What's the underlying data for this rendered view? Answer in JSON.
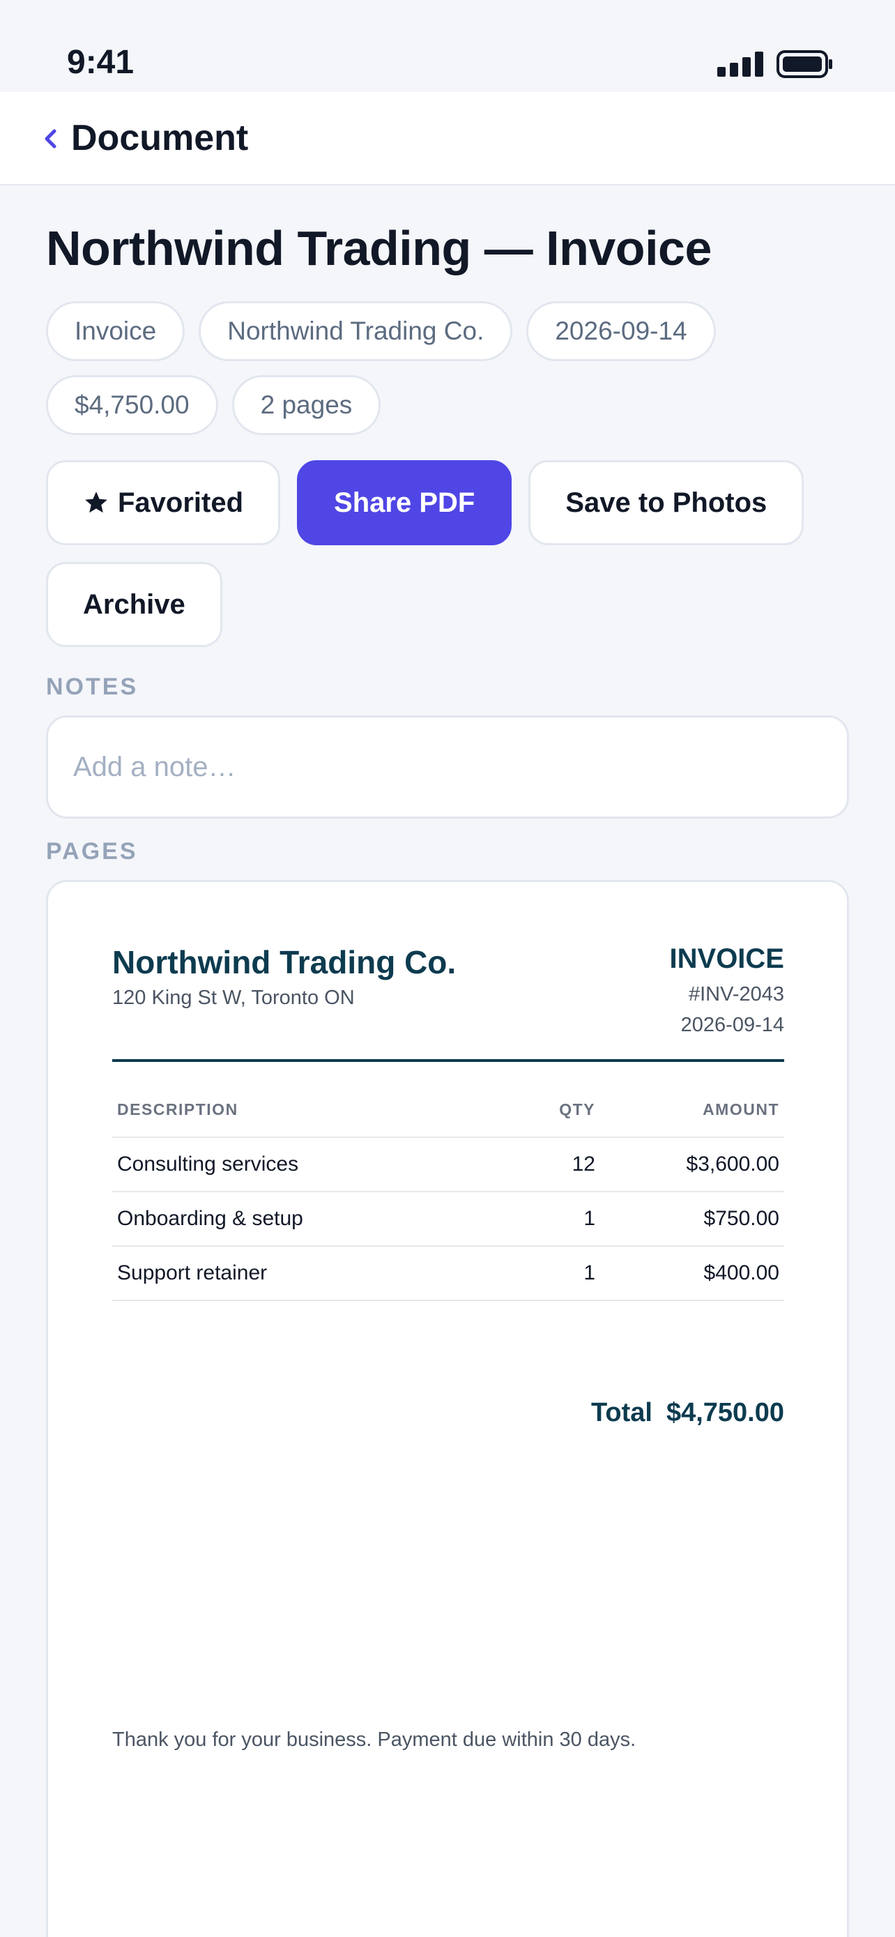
{
  "status_bar": {
    "time": "9:41"
  },
  "nav": {
    "title": "Document"
  },
  "document": {
    "title": "Northwind Trading — Invoice",
    "chips": [
      "Invoice",
      "Northwind Trading Co.",
      "2026-09-14",
      "$4,750.00",
      "2 pages"
    ]
  },
  "actions": {
    "favorited": "Favorited",
    "share_pdf": "Share PDF",
    "save_to_photos": "Save to Photos",
    "archive": "Archive"
  },
  "notes": {
    "label": "NOTES",
    "placeholder": "Add a note…",
    "value": ""
  },
  "pages": {
    "label": "PAGES"
  },
  "invoice": {
    "company": "Northwind Trading Co.",
    "address": "120 King St W, Toronto ON",
    "label": "INVOICE",
    "number": "#INV-2043",
    "date": "2026-09-14",
    "columns": [
      "DESCRIPTION",
      "QTY",
      "AMOUNT"
    ],
    "rows": [
      {
        "description": "Consulting services",
        "qty": "12",
        "amount": "$3,600.00"
      },
      {
        "description": "Onboarding & setup",
        "qty": "1",
        "amount": "$750.00"
      },
      {
        "description": "Support retainer",
        "qty": "1",
        "amount": "$400.00"
      }
    ],
    "total_label": "Total",
    "total_value": "$4,750.00",
    "footer": "Thank you for your business. Payment due within 30 days."
  },
  "colors": {
    "accent": "#4f46e5",
    "background": "#f4f6fa",
    "invoice_brand": "#0d3b4f",
    "muted_text": "#5c6b80"
  }
}
